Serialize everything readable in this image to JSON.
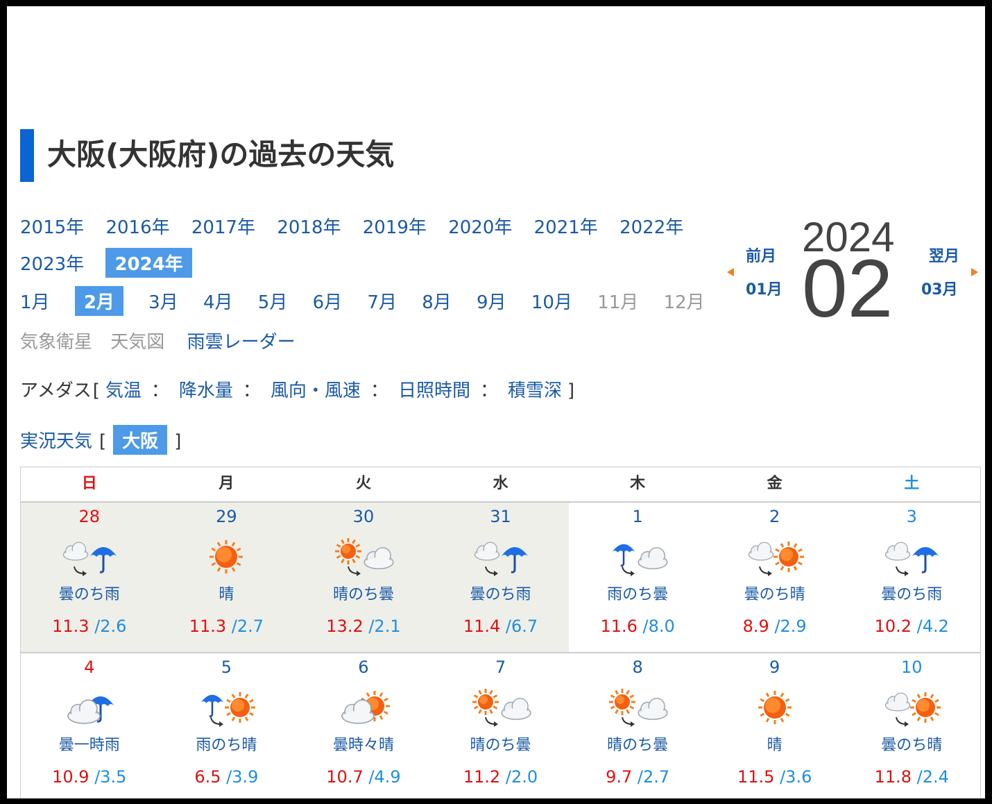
{
  "page_title": "大阪(大阪府)の過去の天気",
  "years": [
    "2015年",
    "2016年",
    "2017年",
    "2018年",
    "2019年",
    "2020年",
    "2021年",
    "2022年",
    "2023年",
    "2024年"
  ],
  "selected_year": "2024年",
  "months": [
    "1月",
    "2月",
    "3月",
    "4月",
    "5月",
    "6月",
    "7月",
    "8月",
    "9月",
    "10月",
    "11月",
    "12月"
  ],
  "links": {
    "satellite": "気象衛星",
    "chart": "天気図",
    "radar": "雨雲レーダー"
  },
  "amedas": {
    "label": "アメダス",
    "open": "[",
    "close": "]",
    "sep": "：",
    "items": [
      "気温",
      "降水量",
      "風向・風速",
      "日照時間",
      "積雪深"
    ]
  },
  "jikkyo": {
    "label": "実況天気",
    "open": "[",
    "close": "]",
    "station": "大阪"
  },
  "nav": {
    "prev_label": "前月",
    "prev_month": "01月",
    "next_label": "翌月",
    "next_month": "03月",
    "year": "2024",
    "month": "02"
  },
  "weekdays": [
    "日",
    "月",
    "火",
    "水",
    "木",
    "金",
    "土"
  ],
  "weeks": [
    [
      {
        "day": "28",
        "weather": "曇のち雨",
        "hi": "11.3",
        "lo": "/2.6",
        "icon": "cloud-then-rain-icon",
        "past": true
      },
      {
        "day": "29",
        "weather": "晴",
        "hi": "11.3",
        "lo": "/2.7",
        "icon": "sun-icon",
        "past": true
      },
      {
        "day": "30",
        "weather": "晴のち曇",
        "hi": "13.2",
        "lo": "/2.1",
        "icon": "sun-then-cloud-icon",
        "past": true
      },
      {
        "day": "31",
        "weather": "曇のち雨",
        "hi": "11.4",
        "lo": "/6.7",
        "icon": "cloud-then-rain-icon",
        "past": true
      },
      {
        "day": "1",
        "weather": "雨のち曇",
        "hi": "11.6",
        "lo": "/8.0",
        "icon": "rain-then-cloud-icon",
        "past": false
      },
      {
        "day": "2",
        "weather": "曇のち晴",
        "hi": "8.9",
        "lo": "/2.9",
        "icon": "cloud-then-sun-icon",
        "past": false
      },
      {
        "day": "3",
        "weather": "曇のち雨",
        "hi": "10.2",
        "lo": "/4.2",
        "icon": "cloud-then-rain-icon",
        "past": false
      }
    ],
    [
      {
        "day": "4",
        "weather": "曇一時雨",
        "hi": "10.9",
        "lo": "/3.5",
        "icon": "cloud-occasional-rain-icon",
        "past": false
      },
      {
        "day": "5",
        "weather": "雨のち晴",
        "hi": "6.5",
        "lo": "/3.9",
        "icon": "rain-then-sun-icon",
        "past": false
      },
      {
        "day": "6",
        "weather": "曇時々晴",
        "hi": "10.7",
        "lo": "/4.9",
        "icon": "cloud-sometimes-sun-icon",
        "past": false
      },
      {
        "day": "7",
        "weather": "晴のち曇",
        "hi": "11.2",
        "lo": "/2.0",
        "icon": "sun-then-cloud-icon",
        "past": false
      },
      {
        "day": "8",
        "weather": "晴のち曇",
        "hi": "9.7",
        "lo": "/2.7",
        "icon": "sun-then-cloud-icon",
        "past": false
      },
      {
        "day": "9",
        "weather": "晴",
        "hi": "11.5",
        "lo": "/3.6",
        "icon": "sun-icon",
        "past": false
      },
      {
        "day": "10",
        "weather": "曇のち晴",
        "hi": "11.8",
        "lo": "/2.4",
        "icon": "cloud-then-sun-icon",
        "past": false
      }
    ]
  ],
  "colors": {
    "accent": "#0a64d2",
    "link": "#1a5aa6",
    "selected": "#4d9ae8",
    "high_temp": "#e01010",
    "low_temp": "#1e8ee0",
    "past_bg": "#efefea",
    "arrow": "#f08020"
  }
}
